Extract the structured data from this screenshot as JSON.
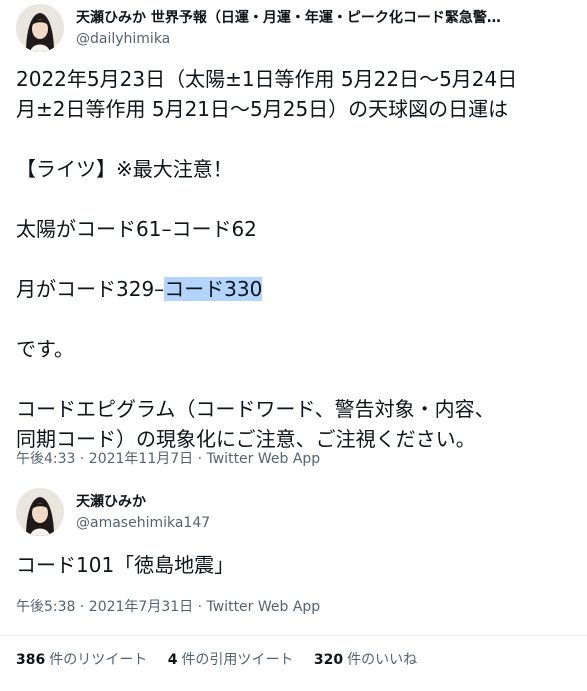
{
  "main_tweet": {
    "display_name": "天瀬ひみか 世界予報（日運・月運・年運・ピーク化コード緊急警…",
    "handle": "@dailyhimika",
    "lines": [
      "2022年5月23日（太陽±1日等作用 5月22日〜5月24日",
      "月±2日等作用 5月21日〜5月25日）の天球図の日運は",
      "",
      "【ライツ】※最大注意！",
      "",
      "太陽がコード61–コード62",
      "",
      "",
      "",
      "です。",
      "",
      "コードエピグラム（コードワード、警告対象・内容、",
      "同期コード）の現象化にご注意、ご注視ください。"
    ],
    "moon_line_prefix": "月がコード329–",
    "moon_line_selected": "コード330",
    "timestamp": "午後4:33 · 2021年11月7日 · ",
    "app": "Twitter Web App"
  },
  "quoted_tweet": {
    "display_name": "天瀬ひみか",
    "handle": "@amasehimika147",
    "text": "コード101「徳島地震」",
    "timestamp": "午後5:38 · 2021年7月31日 · ",
    "app": "Twitter Web App"
  },
  "stats": {
    "retweets_num": "386",
    "retweets_label": "件のリツイート",
    "quotes_num": "4",
    "quotes_label": "件の引用ツイート",
    "likes_num": "320",
    "likes_label": "件のいいね"
  },
  "colors": {
    "text": "#0f1419",
    "secondary": "#536471",
    "selection": "#b3d4fd",
    "divider": "#eff3f4"
  }
}
